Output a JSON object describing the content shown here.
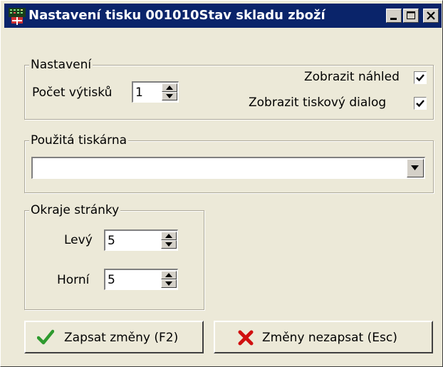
{
  "window": {
    "title": "Nastavení tisku 001010Stav skladu zboží"
  },
  "settings_group": {
    "legend": "Nastavení",
    "copies_label": "Počet výtisků",
    "copies_value": "1",
    "preview_label": "Zobrazit náhled",
    "preview_checked": true,
    "print_dialog_label": "Zobrazit tiskový dialog",
    "print_dialog_checked": true
  },
  "printer_group": {
    "legend": "Použitá tiskárna",
    "selected": ""
  },
  "margins_group": {
    "legend": "Okraje stránky",
    "left_label": "Levý",
    "left_value": "5",
    "top_label": "Horní",
    "top_value": "5"
  },
  "buttons": {
    "save_label": "Zapsat změny (F2)",
    "cancel_label": "Změny nezapsat (Esc)"
  },
  "colors": {
    "title_bar": "#0a246a",
    "face": "#ece9d8",
    "save_icon": "#2e9a2e",
    "cancel_icon": "#d01010"
  },
  "icons": {
    "app": "printer-settings-icon",
    "save": "checkmark-icon",
    "cancel": "x-mark-icon"
  }
}
